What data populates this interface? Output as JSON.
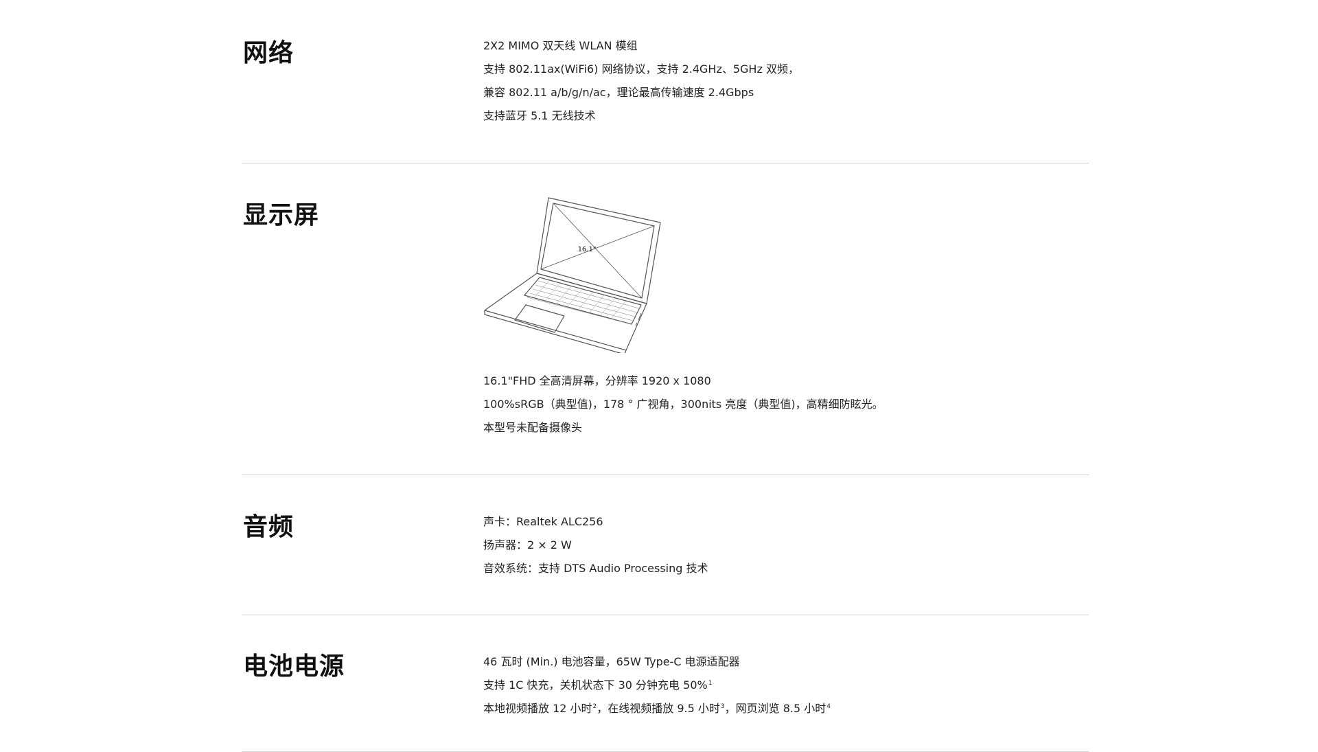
{
  "sections": [
    {
      "title": "网络",
      "lines": [
        {
          "text": "2X2 MIMO 双天线 WLAN 模组"
        },
        {
          "text": "支持 802.11ax(WiFi6) 网络协议，支持 2.4GHz、5GHz 双频，"
        },
        {
          "text": "兼容 802.11 a/b/g/n/ac，理论最高传输速度 2.4Gbps"
        },
        {
          "text": "支持蓝牙 5.1 无线技术"
        }
      ]
    },
    {
      "title": "显示屏",
      "screen_size_label": "16.1\"",
      "lines": [
        {
          "text": "16.1\"FHD 全高清屏幕，分辨率 1920 x 1080"
        },
        {
          "text": "100%sRGB（典型值)，178 ° 广视角，300nits 亮度（典型值)，高精细防眩光。"
        },
        {
          "text": "本型号未配备摄像头"
        }
      ]
    },
    {
      "title": "音频",
      "lines": [
        {
          "text": "声卡：Realtek ALC256"
        },
        {
          "text": "扬声器：2 × 2 W"
        },
        {
          "text": "音效系统：支持 DTS Audio Processing 技术"
        }
      ]
    },
    {
      "title": "电池电源",
      "lines": [
        {
          "text": "46 瓦时 (Min.) 电池容量，65W Type-C 电源适配器"
        },
        {
          "text": "支持 1C 快充，关机状态下 30 分钟充电 50%",
          "sup": "1"
        },
        {
          "text": "本地视频播放 12 小时",
          "sup": "2",
          "text2": "，在线视频播放 9.5 小时",
          "sup2": "3",
          "text3": "，网页浏览 8.5 小时",
          "sup3": "4"
        }
      ]
    }
  ]
}
